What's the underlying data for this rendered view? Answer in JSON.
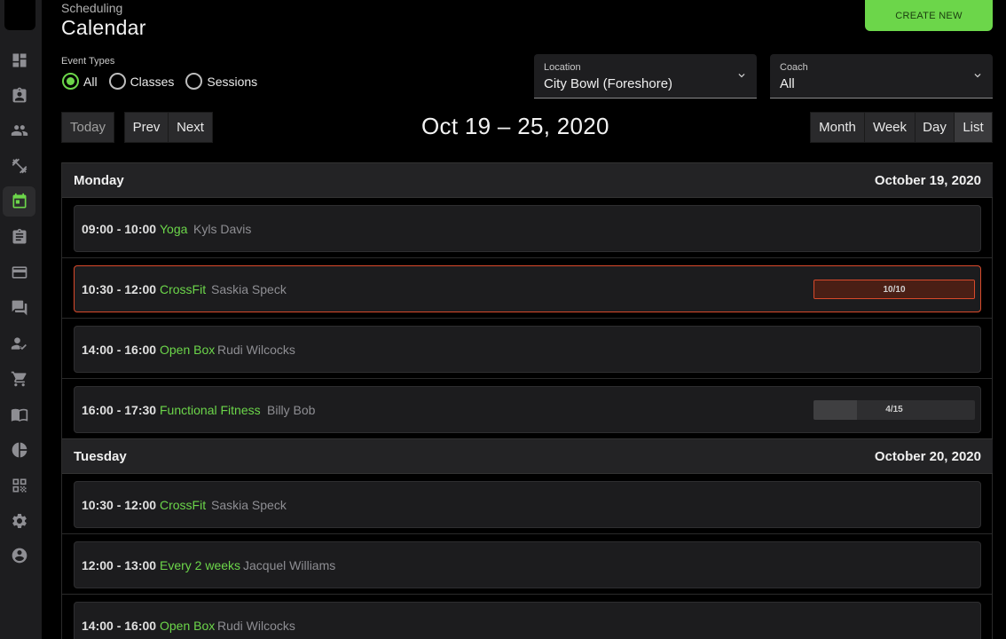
{
  "header": {
    "breadcrumb": "Scheduling",
    "title": "Calendar",
    "create_label": "CREATE NEW"
  },
  "sidebar": {
    "items": [
      {
        "icon": "dashboard-icon"
      },
      {
        "icon": "contact-card-icon"
      },
      {
        "icon": "people-icon"
      },
      {
        "icon": "fitness-icon"
      },
      {
        "icon": "calendar-icon",
        "active": true
      },
      {
        "icon": "clipboard-icon"
      },
      {
        "icon": "ticket-icon"
      },
      {
        "icon": "chat-icon"
      },
      {
        "icon": "user-check-icon"
      },
      {
        "icon": "cart-icon"
      },
      {
        "icon": "book-icon"
      },
      {
        "icon": "pie-chart-icon"
      },
      {
        "icon": "qr-code-icon"
      },
      {
        "icon": "settings-icon"
      },
      {
        "icon": "account-icon"
      }
    ]
  },
  "filters": {
    "event_types_label": "Event Types",
    "options": [
      "All",
      "Classes",
      "Sessions"
    ],
    "selected": "All",
    "location": {
      "label": "Location",
      "value": "City Bowl (Foreshore)"
    },
    "coach": {
      "label": "Coach",
      "value": "All"
    }
  },
  "toolbar": {
    "today": "Today",
    "prev": "Prev",
    "next": "Next",
    "range": "Oct 19 – 25, 2020",
    "views": [
      "Month",
      "Week",
      "Day",
      "List"
    ],
    "active_view": "List"
  },
  "days": [
    {
      "name": "Monday",
      "date": "October 19, 2020",
      "events": [
        {
          "time": "09:00 - 10:00",
          "name": "Yoga",
          "coach": "Kyls Davis"
        },
        {
          "time": "10:30 - 12:00",
          "name": "CrossFit",
          "coach": "Saskia Speck",
          "capacity": "10/10",
          "fill": 1.0,
          "full": true
        },
        {
          "time": "14:00 - 16:00",
          "name": "Open Box",
          "coach": "Rudi Wilcocks"
        },
        {
          "time": "16:00 - 17:30",
          "name": "Functional Fitness",
          "coach": "Billy Bob",
          "capacity": "4/15",
          "fill": 0.267
        }
      ]
    },
    {
      "name": "Tuesday",
      "date": "October 20, 2020",
      "events": [
        {
          "time": "10:30 - 12:00",
          "name": "CrossFit",
          "coach": "Saskia Speck"
        },
        {
          "time": "12:00 - 13:00",
          "name": "Every 2 weeks",
          "coach": "Jacquel Williams"
        },
        {
          "time": "14:00 - 16:00",
          "name": "Open Box",
          "coach": "Rudi Wilcocks"
        }
      ]
    }
  ],
  "colors": {
    "accent": "#6cd64a",
    "alert": "#d94a2b",
    "background": "#000000",
    "sidebar": "#1d1d1f"
  }
}
